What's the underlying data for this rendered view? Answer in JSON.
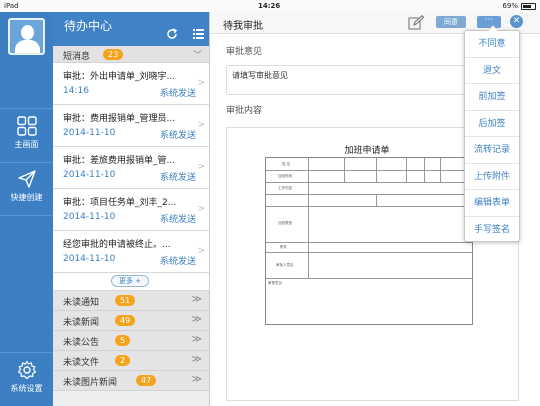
{
  "statusbar": {
    "device": "iPad",
    "time": "14:26",
    "battery": "69%"
  },
  "rail": {
    "items": [
      {
        "label": "主画面",
        "icon": "grid-icon"
      },
      {
        "label": "快捷创建",
        "icon": "send-icon"
      },
      {
        "label": "系统设置",
        "icon": "gear-icon"
      }
    ]
  },
  "list": {
    "title": "待办中心",
    "section_label": "短消息",
    "section_count": "23",
    "messages": [
      {
        "title": "审批：外出申请单_刘晓宇...",
        "date": "14:16",
        "sender": "系统发送"
      },
      {
        "title": "审批：费用报销单_管理员...",
        "date": "2014-11-10",
        "sender": "系统发送"
      },
      {
        "title": "审批：差旅费用报销单_管...",
        "date": "2014-11-10",
        "sender": "系统发送"
      },
      {
        "title": "审批：项目任务单_刘丰_2...",
        "date": "2014-11-10",
        "sender": "系统发送"
      },
      {
        "title": "经您审批的申请被终止。...",
        "date": "2014-11-10",
        "sender": "系统发送"
      }
    ],
    "more_label": "更多 +",
    "categories": [
      {
        "label": "未读通知",
        "count": "51"
      },
      {
        "label": "未读新闻",
        "count": "49"
      },
      {
        "label": "未读公告",
        "count": "5"
      },
      {
        "label": "未读文件",
        "count": "2"
      },
      {
        "label": "未读图片新闻",
        "count": "47"
      }
    ]
  },
  "main": {
    "title": "待我审批",
    "disagree_label": "同意",
    "more_label": "···",
    "opinion_label": "审批意见",
    "opinion_placeholder": "请填写审批意见",
    "content_label": "审批内容",
    "doc_title": "加班申请单"
  },
  "dropdown": {
    "items": [
      "不同意",
      "退文",
      "前加签",
      "后加签",
      "流转记录",
      "上传附件",
      "编辑表单",
      "手写签名"
    ]
  },
  "colors": {
    "accent": "#3f82c6",
    "badge": "#f4a31c",
    "link": "#3a7fc0"
  }
}
